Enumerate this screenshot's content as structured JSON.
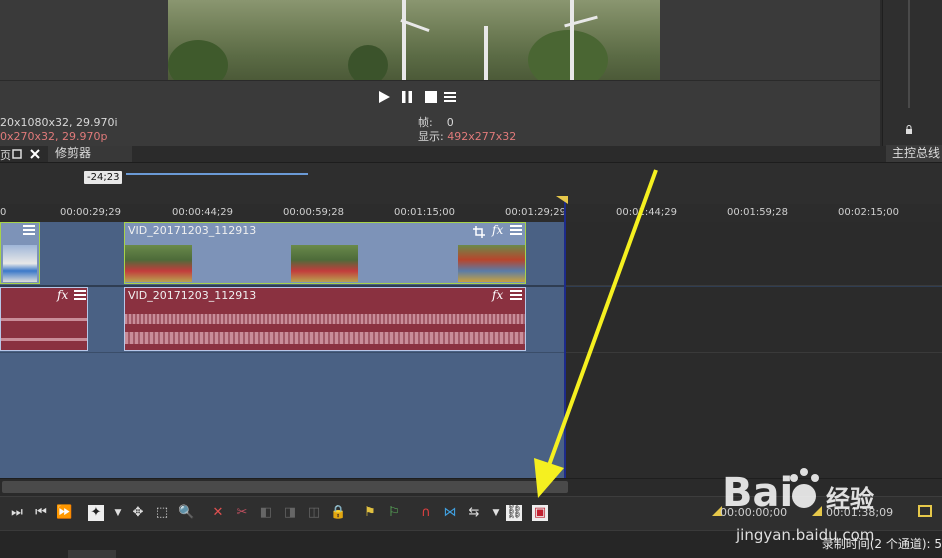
{
  "preview": {
    "info_left_line1": "20x1080x32, 29.970i",
    "info_left_line2": "0x270x32, 29.970p",
    "frame_label": "帧:",
    "frame_value": "0",
    "display_label": "显示:",
    "display_value": "492x277x32"
  },
  "tabs": {
    "trimmer": "修剪器",
    "master_bus": "主控总线"
  },
  "timeline": {
    "marker_time": "-24;23",
    "ruler_ticks": [
      "0",
      "00:00:29;29",
      "00:00:44;29",
      "00:00:59;28",
      "00:01:15;00",
      "00:01:29;29",
      "00:01:44;29",
      "00:01:59;28",
      "00:02:15;00"
    ],
    "video_clip_name": "VID_20171203_112913",
    "audio_clip_name": "VID_20171203_112913",
    "fx_label": "fx"
  },
  "bottom": {
    "time_start": "00:00:00;00",
    "time_end": "00:01:38;09",
    "status": "录制时间(2 个通道): 5"
  },
  "watermark": {
    "brand": "Bai",
    "brand_cn": "经验",
    "url": "jingyan.baidu.com"
  },
  "colors": {
    "accent_blue": "#6b9ad6",
    "video_track": "#7d93b8",
    "audio_track": "#8a3140",
    "arrow": "#f5f020"
  }
}
